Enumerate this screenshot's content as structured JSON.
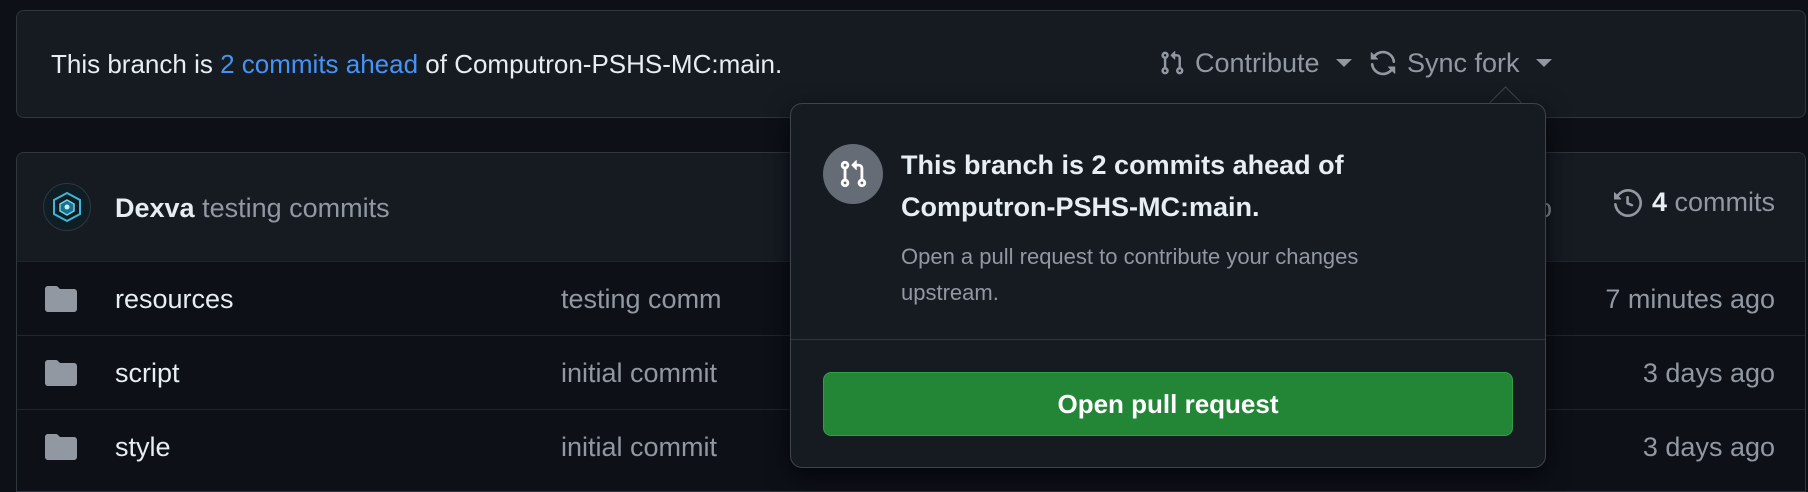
{
  "banner": {
    "prefix": "This branch is ",
    "link": "2 commits ahead",
    "suffix": " of Computron-PSHS-MC:main.",
    "contribute_label": "Contribute",
    "sync_label": "Sync fork"
  },
  "latest_commit": {
    "author": "Dexva",
    "message": "testing commits",
    "time_partial": "go",
    "commit_count": "4",
    "commits_label": "commits"
  },
  "files": [
    {
      "name": "resources",
      "message": "testing comm",
      "time": "7 minutes ago"
    },
    {
      "name": "script",
      "message": "initial commit",
      "time": "3 days ago"
    },
    {
      "name": "style",
      "message": "initial commit",
      "time": "3 days ago"
    }
  ],
  "popover": {
    "title": "This branch is 2 commits ahead of Computron-PSHS-MC:main.",
    "description": "Open a pull request to contribute your changes upstream.",
    "button": "Open pull request"
  },
  "colors": {
    "background": "#0d1117",
    "panel": "#161b22",
    "link": "#4493f8",
    "primary_button": "#238636",
    "muted_text": "#9198a1"
  }
}
